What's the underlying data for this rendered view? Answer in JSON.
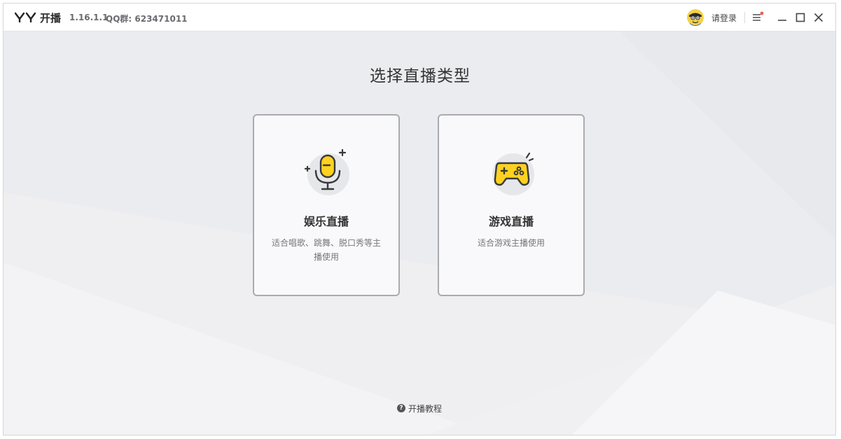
{
  "app": {
    "name": "开播",
    "version": "1.16.1.1",
    "qq_group": "QQ群: 623471011"
  },
  "titlebar": {
    "login_label": "请登录",
    "icons": [
      "yy-logo-icon",
      "avatar-icon",
      "menu-icon",
      "minimize-icon",
      "maximize-icon",
      "close-icon"
    ],
    "notification_dot_color": "#f25b4c"
  },
  "main": {
    "title": "选择直播类型",
    "cards": [
      {
        "title": "娱乐直播",
        "description": "适合唱歌、跳舞、脱口秀等主播使用",
        "icon": "microphone-icon"
      },
      {
        "title": "游戏直播",
        "description": "适合游戏主播使用",
        "icon": "gamepad-icon"
      }
    ],
    "tutorial_label": "开播教程"
  },
  "colors": {
    "accent_yellow": "#ffd21f",
    "icon_stroke": "#3a3a3a",
    "card_border": "#a9abb0",
    "background": "#ebecf0"
  }
}
